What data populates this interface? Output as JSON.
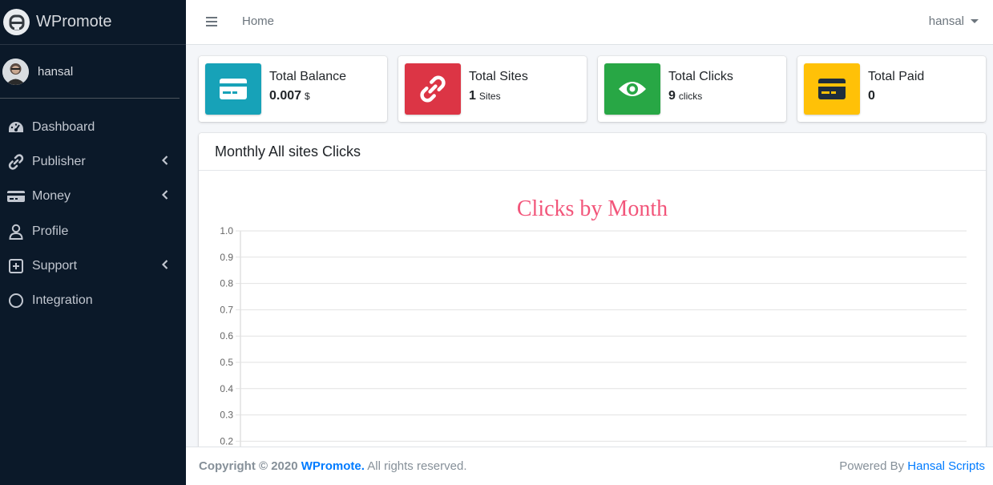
{
  "brand": {
    "name": "WPromote"
  },
  "user": {
    "name": "hansal"
  },
  "sidebar": {
    "items": [
      {
        "label": "Dashboard",
        "icon": "tachometer-icon",
        "has_submenu": false
      },
      {
        "label": "Publisher",
        "icon": "link-icon",
        "has_submenu": true
      },
      {
        "label": "Money",
        "icon": "credit-card-icon",
        "has_submenu": true
      },
      {
        "label": "Profile",
        "icon": "user-icon",
        "has_submenu": false
      },
      {
        "label": "Support",
        "icon": "plus-square-icon",
        "has_submenu": true
      },
      {
        "label": "Integration",
        "icon": "circle-icon",
        "has_submenu": false
      }
    ]
  },
  "header": {
    "home_label": "Home",
    "user_menu_label": "hansal"
  },
  "info_boxes": [
    {
      "label": "Total Balance",
      "value": "0.007",
      "unit": "$",
      "color": "#17a2b8",
      "icon": "credit-card-icon"
    },
    {
      "label": "Total Sites",
      "value": "1",
      "unit": "Sites",
      "color": "#dc3545",
      "icon": "link-icon"
    },
    {
      "label": "Total Clicks",
      "value": "9",
      "unit": "clicks",
      "color": "#28a745",
      "icon": "eye-icon"
    },
    {
      "label": "Total Paid",
      "value": "0",
      "unit": "",
      "color": "#ffc107",
      "icon": "money-card-icon"
    }
  ],
  "card": {
    "title": "Monthly All sites Clicks"
  },
  "chart_data": {
    "type": "line",
    "title": "Clicks by Month",
    "title_color": "#f2557a",
    "yticks": [
      "1.0",
      "0.9",
      "0.8",
      "0.7",
      "0.6",
      "0.5",
      "0.4",
      "0.3",
      "0.2"
    ],
    "ylim": [
      0,
      1.0
    ],
    "grid": true,
    "series": []
  },
  "footer": {
    "copyright_prefix": "Copyright © 2020",
    "brand_link": "WPromote.",
    "rights": "All rights reserved.",
    "powered_by": "Powered By",
    "powered_link": "Hansal Scripts"
  }
}
